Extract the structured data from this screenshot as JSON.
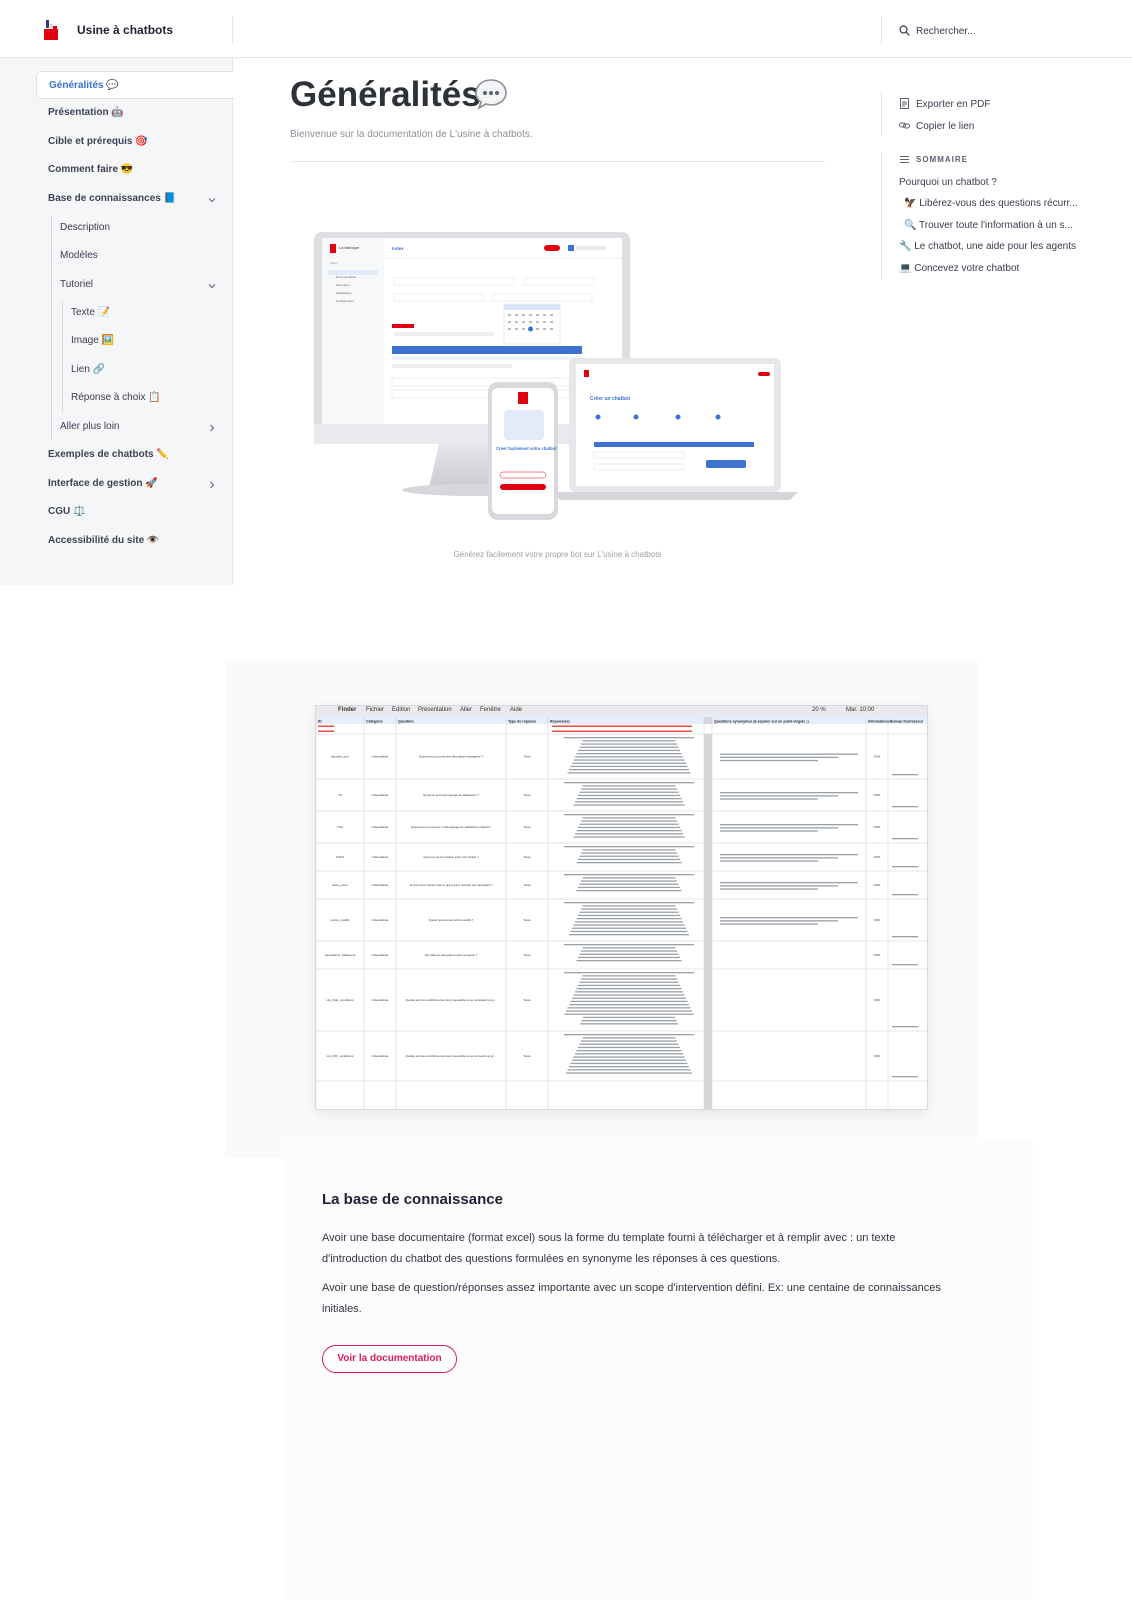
{
  "header": {
    "brand": "Usine à chatbots",
    "search_placeholder": "Rechercher..."
  },
  "sidebar": {
    "items": [
      {
        "label": "Généralités 💬"
      },
      {
        "label": "Présentation 🤖"
      },
      {
        "label": "Cible et prérequis 🎯"
      },
      {
        "label": "Comment faire 😎"
      },
      {
        "label": "Base de connaissances 📘"
      },
      {
        "label": "Description"
      },
      {
        "label": "Modèles"
      },
      {
        "label": "Tutoriel"
      },
      {
        "label": "Texte 📝"
      },
      {
        "label": "Image 🖼️"
      },
      {
        "label": "Lien 🔗"
      },
      {
        "label": "Réponse à choix 📋"
      },
      {
        "label": "Aller plus loin"
      },
      {
        "label": "Exemples de chatbots ✏️"
      },
      {
        "label": "Interface de gestion 🚀"
      },
      {
        "label": "CGU ⚖️"
      },
      {
        "label": "Accessibilité du site 👁️"
      }
    ]
  },
  "main": {
    "title": "Généralités",
    "subtitle": "Bienvenue sur la documentation de L'usine à chatbots.",
    "hero_caption": "Générez facilement votre propre bot sur L'usine à chatbots",
    "hero_mock": {
      "desktop_header": "Index",
      "sidebar_lines": [
        "Index",
        "Documentation",
        "Historique",
        "Statistiques",
        "Configuration"
      ],
      "laptop_title": "Créer un chatbot",
      "phone_title": "Créer facilement votre chatbot",
      "phone_button": "Créer mon chatbot"
    }
  },
  "toc": {
    "export_pdf": "Exporter en PDF",
    "copy_link": "Copier le lien",
    "sommaire": "SOMMAIRE",
    "items": [
      "Pourquoi un chatbot ?",
      "🦅 Libérez-vous des questions récurr...",
      "🔍 Trouver toute l'information à un s...",
      "🔧 Le chatbot, une aide pour les agents",
      "💻 Concevez votre chatbot"
    ]
  },
  "sheet": {
    "menubar": [
      "Finder",
      "Fichier",
      "Édition",
      "Présentation",
      "Aller",
      "Fenêtre",
      "Aide"
    ],
    "clock": "Mar. 10:00",
    "battery": "20 %",
    "headers": [
      "ID",
      "Catégorie",
      "Question",
      "Type de réponse",
      "Réponse(s)",
      "",
      "Questions synonymes (à séparer sur un point-virgule ;)",
      "Informations",
      "Bureau fournisseur"
    ],
    "rows": [
      {
        "id": "decoder_porr",
        "cat": "Chancellerie",
        "q": "Quand peut-on porter des décorations étrangères ?",
        "type": "Texte",
        "flag": "NON"
      },
      {
        "id": "TS",
        "cat": "Chancellerie",
        "q": "Qu'est-ce qu'un témoignage de satisfaction ?",
        "type": "Texte",
        "flag": "NON"
      },
      {
        "id": "TSC",
        "cat": "Chancellerie",
        "q": "Quand peut-on recevoir un témoignage de satisfaction collectif ?",
        "type": "Texte",
        "flag": "NON"
      },
      {
        "id": "CSCS",
        "cat": "Chancellerie",
        "q": "Qu'est-ce qu'une citation sans croix simple ?",
        "type": "Texte",
        "flag": "NON"
      },
      {
        "id": "deco_youm",
        "cat": "Chancellerie",
        "q": "Je suis sous-marinier. Est-ce que je peux recevoir une décoration ?",
        "type": "Texte",
        "flag": "NON"
      },
      {
        "id": "points_positifs",
        "cat": "Chancellerie",
        "q": "Quand recevoir des points positifs ?",
        "type": "Texte",
        "flag": "NON"
      },
      {
        "id": "decorations_traitement",
        "cat": "Chancellerie",
        "q": "Qui traite les décorations dans la marine ?",
        "type": "Texte",
        "flag": "NON"
      },
      {
        "id": "LH_CHE_conditions",
        "cat": "Chancellerie",
        "q": "Quelles sont les conditions pour être proposable à une nomination au grade de chevalier de l'Ordre de la Légion d'Honneur ?",
        "type": "Texte",
        "flag": "NON"
      },
      {
        "id": "LH_OFF_conditions",
        "cat": "Chancellerie",
        "q": "Quelles sont les conditions pour être proposable à une promotion au grade d'officier de l'Ordre de la Légion d'Honneur ?",
        "type": "Texte",
        "flag": "NON"
      }
    ]
  },
  "card": {
    "title": "La base de connaissance",
    "para1": "Avoir une base documentaire (format excel) sous la forme du template fourni à télécharger et à remplir avec : un texte d'introduction du chatbot des questions formulées en synonyme les réponses à ces questions.",
    "para2": "Avoir une base de question/réponses assez importante avec un scope d'intervention défini. Ex: une centaine de connaissances initiales.",
    "button": "Voir la documentation"
  },
  "colors": {
    "accent_blue": "#3d72d3",
    "brand_red": "#e1000f",
    "button_pink": "#d81b60"
  }
}
